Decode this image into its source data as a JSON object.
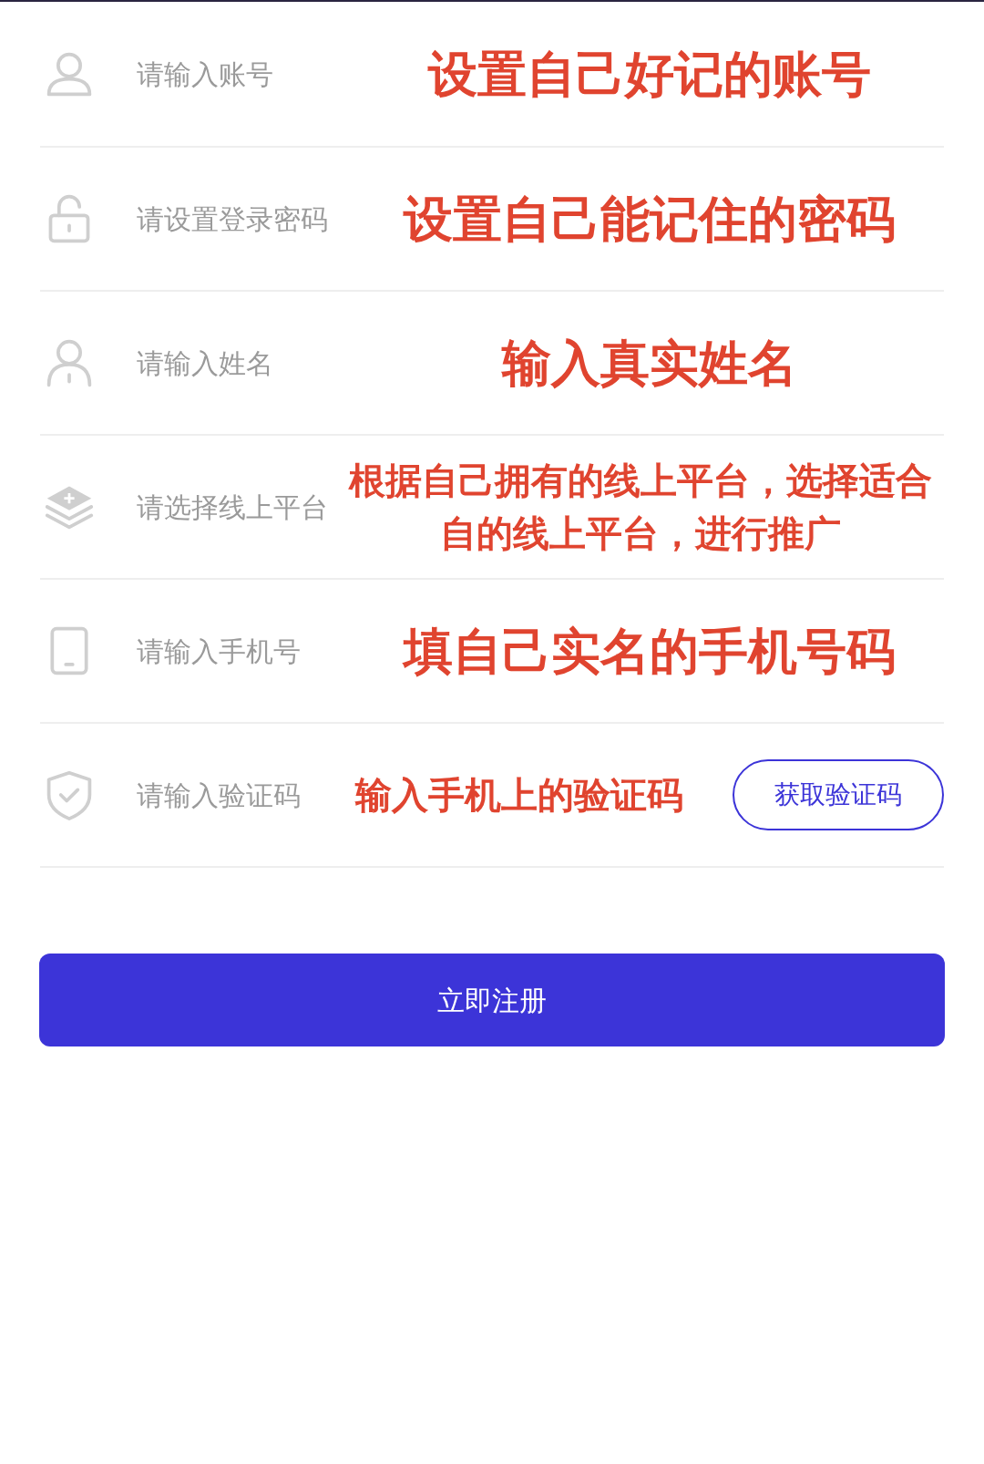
{
  "form": {
    "rows": [
      {
        "kind": "user",
        "placeholder": "请输入账号",
        "annotation": "设置自己好记的账号"
      },
      {
        "kind": "lock",
        "placeholder": "请设置登录密码",
        "annotation": "设置自己能记住的密码"
      },
      {
        "kind": "person",
        "placeholder": "请输入姓名",
        "annotation": "输入真实姓名"
      },
      {
        "kind": "layers",
        "placeholder": "请选择线上平台",
        "annotation": "根据自己拥有的线上平台，选择适合自的线上平台，进行推广"
      },
      {
        "kind": "phone",
        "placeholder": "请输入手机号",
        "annotation": "填自己实名的手机号码"
      },
      {
        "kind": "shield",
        "placeholder": "请输入验证码",
        "annotation": "输入手机上的验证码",
        "button": "获取验证码"
      }
    ]
  },
  "submit": "立即注册"
}
